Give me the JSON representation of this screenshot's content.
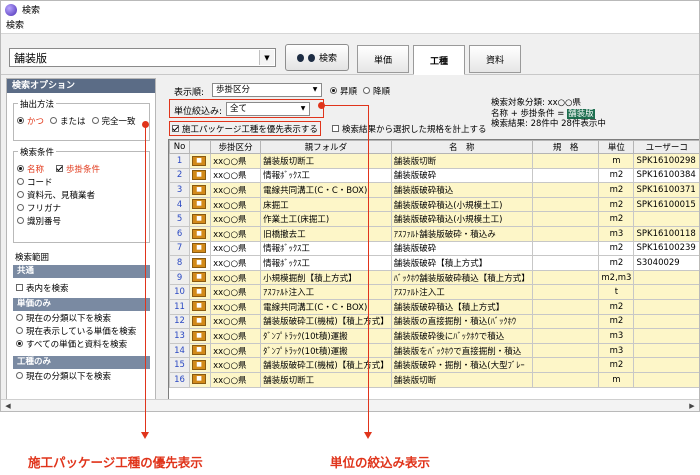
{
  "window": {
    "title": "検索",
    "menu": [
      "検索"
    ]
  },
  "search": {
    "keyword": "舗装版",
    "button": "検索"
  },
  "tabs": [
    {
      "label": "単価",
      "active": false
    },
    {
      "label": "工種",
      "active": true
    },
    {
      "label": "資料",
      "active": false
    }
  ],
  "left": {
    "header": "検索オプション",
    "extract": {
      "legend": "抽出方法",
      "options": [
        "かつ",
        "または",
        "完全一致"
      ],
      "selected": 0
    },
    "conditions": {
      "legend": "検索条件",
      "items": [
        {
          "label": "名称",
          "on": true,
          "red": true
        },
        {
          "label": "歩掛条件",
          "on": true,
          "red": true,
          "type": "check"
        },
        {
          "label": "コード",
          "on": false
        },
        {
          "label": "資料元、見積業者",
          "on": false
        },
        {
          "label": "フリガナ",
          "on": false
        },
        {
          "label": "識別番号",
          "on": false
        }
      ]
    },
    "range": {
      "legend": "検索範囲",
      "common": "共通",
      "common_check": "表内を検索",
      "unit_only": "単価のみ",
      "unit_opts": [
        "現在の分類以下を検索",
        "現在表示している単価を検索",
        "すべての単価と資料を検索"
      ],
      "unit_selected": 2,
      "kosyu_only": "工種のみ",
      "kosyu_opts": [
        "現在の分類以下を検索"
      ]
    }
  },
  "main": {
    "sort_label": "表示順:",
    "sort_value": "歩掛区分",
    "asc": "昇順",
    "desc": "降順",
    "filter_label": "単位絞込み:",
    "filter_value": "全て",
    "prefer_label": "施工パッケージ工種を優先表示する",
    "calc_label": "検索結果から選択した規格を計上する",
    "info": {
      "line1": "検索対象分類: xx○○県",
      "line2a": "名称 + 歩掛条件 = ",
      "line2b": "舗装版",
      "line3": "検索結果: 28件中 28件表示中"
    },
    "columns": [
      "No",
      "",
      "歩掛区分",
      "親フォルダ",
      "名　称",
      "規　格",
      "単位",
      "ユーザーコ"
    ],
    "rows": [
      {
        "no": "1",
        "kubun": "xx○○県",
        "parent": "舗装版切断工",
        "name": "舗装版切断",
        "unit": "m",
        "code": "SPK16100298"
      },
      {
        "no": "2",
        "kubun": "xx○○県",
        "parent": "情報ﾎﾞｯｸｽ工",
        "name": "舗装版破砕",
        "unit": "m2",
        "code": "SPK16100384"
      },
      {
        "no": "3",
        "kubun": "xx○○県",
        "parent": "電線共同溝工(C・C・BOX)",
        "name": "舗装版破砕積込",
        "unit": "m2",
        "code": "SPK16100371"
      },
      {
        "no": "4",
        "kubun": "xx○○県",
        "parent": "床掘工",
        "name": "舗装版破砕積込(小規模土工)",
        "unit": "m2",
        "code": "SPK16100015"
      },
      {
        "no": "5",
        "kubun": "xx○○県",
        "parent": "作業土工(床掘工)",
        "name": "舗装版破砕積込(小規模土工)",
        "unit": "m2",
        "code": ""
      },
      {
        "no": "6",
        "kubun": "xx○○県",
        "parent": "旧橋撤去工",
        "name": "ｱｽﾌｧﾙﾄ舗装版破砕・積込み",
        "unit": "m3",
        "code": "SPK16100118"
      },
      {
        "no": "7",
        "kubun": "xx○○県",
        "parent": "情報ﾎﾞｯｸｽ工",
        "name": "舗装版破砕",
        "unit": "m2",
        "code": "SPK16100239"
      },
      {
        "no": "8",
        "kubun": "xx○○県",
        "parent": "情報ﾎﾞｯｸｽ工",
        "name": "舗装版破砕【積上方式】",
        "unit": "m2",
        "code": "S3040029"
      },
      {
        "no": "9",
        "kubun": "xx○○県",
        "parent": "小規模掘削【積上方式】",
        "name": "ﾊﾞｯｸﾎｳ舗装版破砕積込【積上方式】",
        "unit": "m2,m3",
        "code": ""
      },
      {
        "no": "10",
        "kubun": "xx○○県",
        "parent": "ｱｽﾌｧﾙﾄ注入工",
        "name": "ｱｽﾌｧﾙﾄ注入工",
        "unit": "t",
        "code": ""
      },
      {
        "no": "11",
        "kubun": "xx○○県",
        "parent": "電線共同溝工(C・C・BOX)",
        "name": "舗装版破砕積込【積上方式】",
        "unit": "m2",
        "code": ""
      },
      {
        "no": "12",
        "kubun": "xx○○県",
        "parent": "舗装版破砕工(機械)【積上方式】",
        "name": "舗装版の直接掘削・積込(ﾊﾞｯｸﾎｳ",
        "unit": "m2",
        "code": ""
      },
      {
        "no": "13",
        "kubun": "xx○○県",
        "parent": "ﾀﾞﾝﾌﾟﾄﾗｯｸ(10t積)運搬",
        "name": "舗装版破砕後にﾊﾞｯｸﾎｳで積込",
        "unit": "m3",
        "code": ""
      },
      {
        "no": "14",
        "kubun": "xx○○県",
        "parent": "ﾀﾞﾝﾌﾟﾄﾗｯｸ(10t積)運搬",
        "name": "舗装版をﾊﾞｯｸﾎｳで直接掘削・積込",
        "unit": "m3",
        "code": ""
      },
      {
        "no": "15",
        "kubun": "xx○○県",
        "parent": "舗装版破砕工(機械)【積上方式】",
        "name": "舗装版破砕・掘削・積込(大型ﾌﾞﾚｰ",
        "unit": "m2",
        "code": ""
      },
      {
        "no": "16",
        "kubun": "xx○○県",
        "parent": "舗装版切断工",
        "name": "舗装版切断",
        "unit": "m",
        "code": ""
      }
    ]
  },
  "annotations": {
    "left": "施工パッケージ工種の優先表示",
    "right": "単位の絞込み表示"
  },
  "colors": {
    "accent": "#e0341b",
    "header": "#5b6c86",
    "row_yellow": "#fdf6c8"
  }
}
